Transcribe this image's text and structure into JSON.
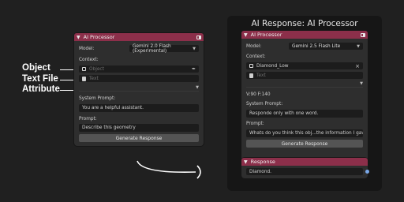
{
  "annotations": {
    "object": "Object",
    "text_file": "Text File",
    "attribute": "Attribute"
  },
  "left_node": {
    "title": "AI Processor",
    "model_label": "Model:",
    "model_value": "Gemini 2.0 Flash (Experimental)",
    "context_label": "Context:",
    "object_placeholder": "Object",
    "text_placeholder": "Text",
    "system_prompt_label": "System Prompt:",
    "system_prompt_value": "You are a helpful assistant.",
    "prompt_label": "Prompt:",
    "prompt_value": "Describe this geometry",
    "generate_label": "Generate Response"
  },
  "right_panel": {
    "heading": "AI Response: AI Processor",
    "node": {
      "title": "AI Processor",
      "model_label": "Model:",
      "model_value": "Gemini 2.5 Flash Lite",
      "context_label": "Context:",
      "object_value": "Diamond_Low",
      "text_placeholder": "Text",
      "stats": "V:90 F:140",
      "system_prompt_label": "System Prompt:",
      "system_prompt_value": "Responde only with one word.",
      "prompt_label": "Prompt:",
      "prompt_value": "Whats do you think this obj...the information I gave you?",
      "generate_label": "Generate Response"
    },
    "response_node": {
      "title": "Response",
      "value": "Diamond."
    }
  },
  "colors": {
    "background": "#202020",
    "panel": "#2e2e2e",
    "header": "#8c2f4a",
    "socket": "#7aa8e8"
  }
}
